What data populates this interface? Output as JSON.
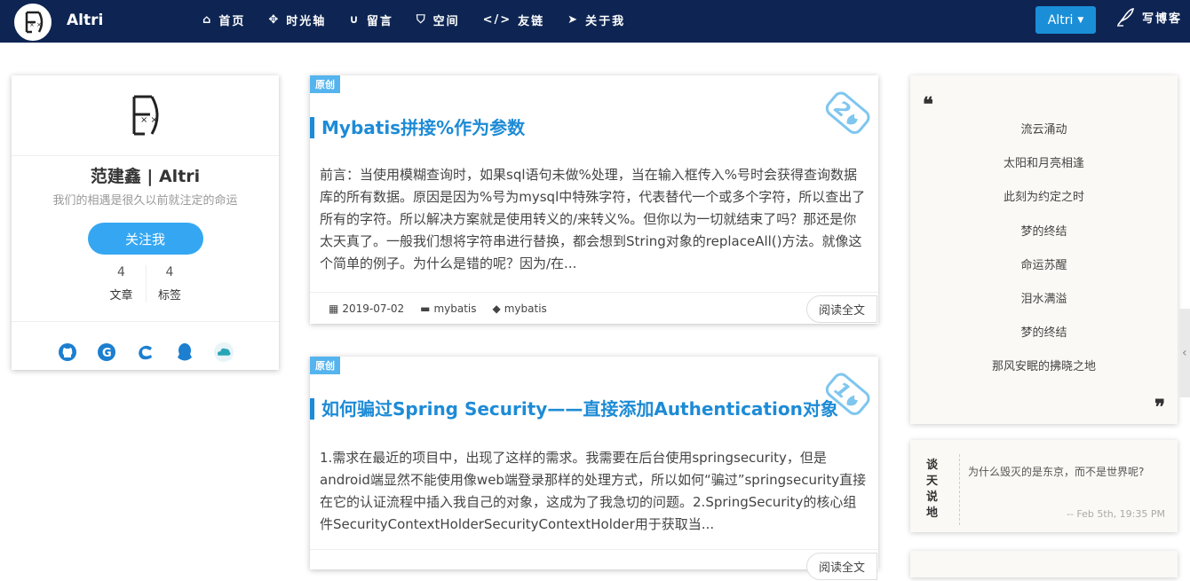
{
  "header": {
    "brand": "Altri",
    "menu": [
      {
        "icon": "home-icon",
        "glyph": "⌂",
        "label": "首页"
      },
      {
        "icon": "arrows-icon",
        "glyph": "✥",
        "label": "时光轴"
      },
      {
        "icon": "magnet-icon",
        "glyph": "∪",
        "label": "留言"
      },
      {
        "icon": "shield-icon",
        "glyph": "⛉",
        "label": "空间"
      },
      {
        "icon": "code-icon",
        "glyph": "</>",
        "label": "友链"
      },
      {
        "icon": "pointer-icon",
        "glyph": "➤",
        "label": "关于我"
      }
    ],
    "user_button": "Altri",
    "write_label": "写博客"
  },
  "profile": {
    "name": "范建鑫 | Altri",
    "motto": "我们的相遇是很久以前就注定的命运",
    "follow_label": "关注我",
    "stats": [
      {
        "value": "4",
        "label": "文章"
      },
      {
        "value": "4",
        "label": "标签"
      }
    ],
    "social": [
      "github-icon",
      "google-icon",
      "csdn-icon",
      "qq-icon",
      "cloud-icon"
    ]
  },
  "articles": [
    {
      "tag": "原创",
      "badge": "2",
      "title": "Mybatis拼接%作为参数",
      "summary": " 前言：当使用模糊查询时，如果sql语句未做%处理，当在输入框传入%号时会获得查询数据库的所有数据。原因是因为%号为mysql中特殊字符，代表替代一个或多个字符，所以查出了所有的字符。所以解决方案就是使用转义的/来转义%。但你以为一切就结束了吗？那还是你太天真了。一般我们想将字符串进行替换，都会想到String对象的replaceAll()方法。就像这个简单的例子。为什么是错的呢？因为/在...",
      "date": "2019-07-02",
      "category": "mybatis",
      "tags": "mybatis",
      "read_more": "阅读全文"
    },
    {
      "tag": "原创",
      "badge": "1",
      "title": "如何骗过Spring Security——直接添加Authentication对象",
      "summary": " 1.需求在最近的项目中，出现了这样的需求。我需要在后台使用springsecurity，但是android端显然不能使用像web端登录那样的处理方式，所以如何“骗过”springsecurity直接在它的认证流程中插入我自己的对象，这成为了我急切的问题。2.SpringSecurity的核心组件SecurityContextHolderSecurityContextHolder用于获取当...",
      "read_more": "阅读全文"
    }
  ],
  "poem": {
    "lines": [
      "流云涌动",
      "太阳和月亮相逢",
      "此刻为约定之时",
      "梦的终结",
      "命运苏醒",
      "泪水满溢",
      "梦的终结",
      "那风安眠的拂晓之地"
    ]
  },
  "talk": {
    "label": "谈天说地",
    "text": "为什么毁灭的是东京，而不是世界呢?",
    "date": "-- Feb 5th, 19:35 PM"
  },
  "colors": {
    "nav": "#0e2553",
    "accent": "#1d8bd6",
    "button": "#35a7f2"
  }
}
